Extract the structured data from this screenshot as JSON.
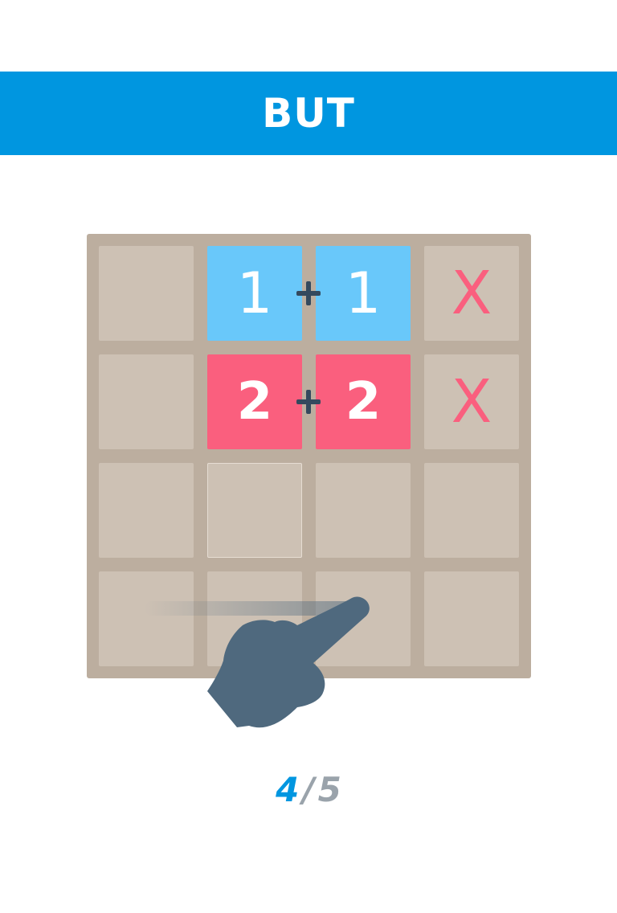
{
  "banner": {
    "title": "BUT"
  },
  "board": {
    "rows": [
      [
        {
          "type": "empty"
        },
        {
          "type": "tile",
          "color": "blue",
          "value": "1"
        },
        {
          "type": "tile",
          "color": "blue",
          "value": "1"
        },
        {
          "type": "mark",
          "value": "X"
        }
      ],
      [
        {
          "type": "empty"
        },
        {
          "type": "tile",
          "color": "pink",
          "value": "2"
        },
        {
          "type": "tile",
          "color": "pink",
          "value": "2"
        },
        {
          "type": "mark",
          "value": "X"
        }
      ],
      [
        {
          "type": "empty"
        },
        {
          "type": "empty",
          "highlight": true
        },
        {
          "type": "empty"
        },
        {
          "type": "empty"
        }
      ],
      [
        {
          "type": "empty"
        },
        {
          "type": "empty"
        },
        {
          "type": "empty"
        },
        {
          "type": "empty"
        }
      ]
    ],
    "operators": [
      "plus-icon",
      "plus-icon"
    ],
    "gesture": "swipe-hand-icon"
  },
  "colors": {
    "accent": "#0096e0",
    "blue_tile": "#69c8fa",
    "pink_tile": "#fa5f7e",
    "board": "#bcae9f",
    "cell": "#cdc1b4",
    "hand": "#4f697e"
  },
  "progress": {
    "current": "4",
    "separator": "/",
    "total": "5"
  }
}
